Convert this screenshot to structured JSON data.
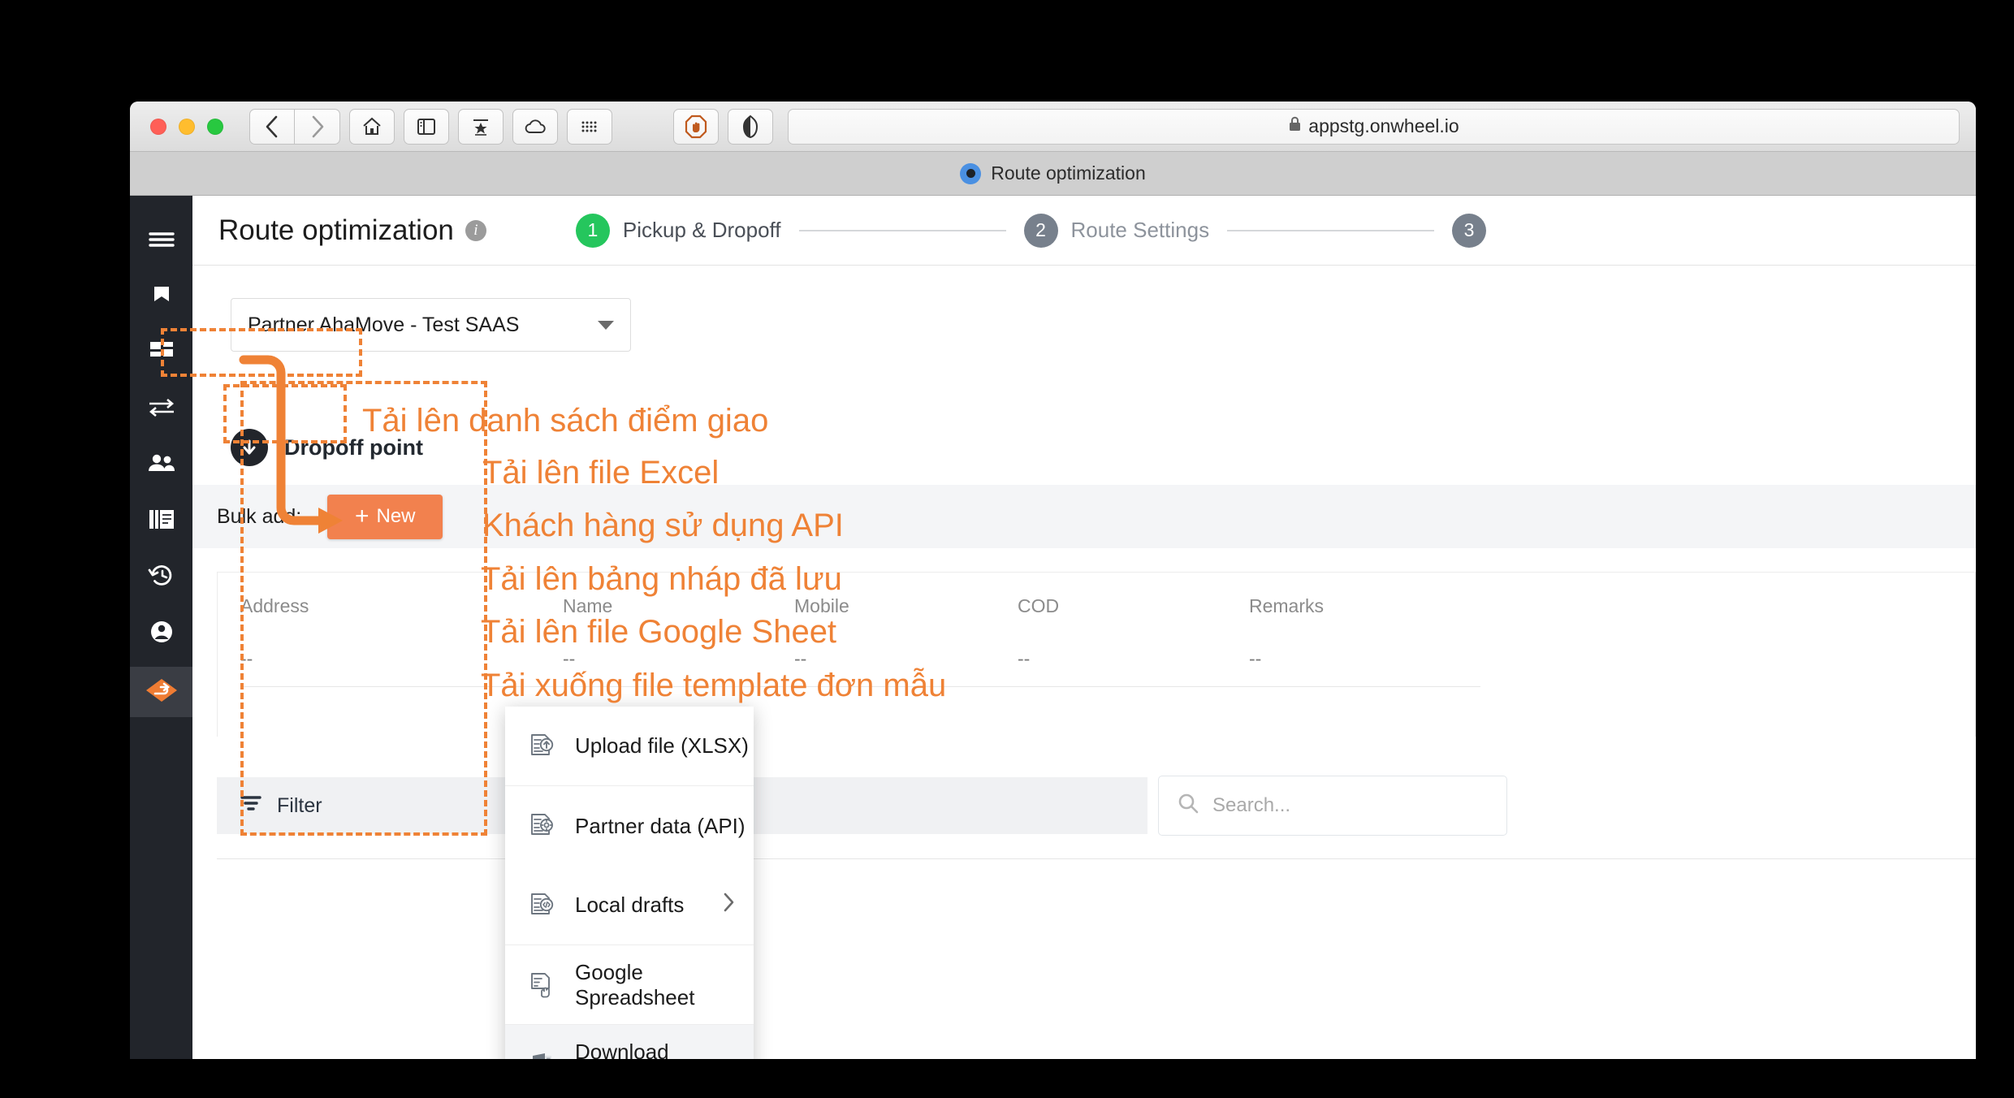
{
  "browser": {
    "url": "appstg.onwheel.io",
    "lock_icon": "lock-icon",
    "tab_title": "Route optimization",
    "toolbar_icons": [
      "back-icon",
      "forward-icon",
      "home-icon",
      "sidebar-icon",
      "reading-list-icon",
      "icloud-icon",
      "grid-icon",
      "adblock-icon",
      "privacy-icon"
    ]
  },
  "sidebar": {
    "items": [
      {
        "name": "menu-hamburger",
        "icon": "hamburger-icon"
      },
      {
        "name": "bookmark",
        "icon": "bookmark-icon"
      },
      {
        "name": "dashboard",
        "icon": "dashboard-icon"
      },
      {
        "name": "transfers",
        "icon": "transfer-arrows-icon"
      },
      {
        "name": "customers",
        "icon": "people-icon"
      },
      {
        "name": "orders",
        "icon": "documents-icon"
      },
      {
        "name": "history",
        "icon": "history-clock-icon"
      },
      {
        "name": "account",
        "icon": "account-circle-icon"
      },
      {
        "name": "route-optimization",
        "icon": "route-diamond-icon",
        "active": true
      }
    ]
  },
  "header": {
    "title": "Route optimization",
    "info_icon": "info-icon",
    "steps": [
      {
        "number": "1",
        "label": "Pickup & Dropoff",
        "state": "done"
      },
      {
        "number": "2",
        "label": "Route Settings",
        "state": "pending"
      },
      {
        "number": "3",
        "label": "",
        "state": "pending"
      }
    ]
  },
  "content": {
    "partner_select": {
      "value": "Partner AhaMove - Test SAAS",
      "caret_icon": "chevron-down-icon"
    },
    "dropoff": {
      "label": "Dropoff point",
      "icon": "arrow-down-icon"
    },
    "bulk_add": {
      "label": "Bulk add:",
      "new_button": "+ New",
      "plus": "+",
      "new_text": "New"
    },
    "table": {
      "columns": [
        "Address",
        "Name",
        "Mobile",
        "COD",
        "Remarks"
      ],
      "rows": [
        [
          "--",
          "--",
          "--",
          "--",
          "--"
        ]
      ]
    },
    "filter": {
      "label": "Filter",
      "icon": "filter-icon"
    },
    "search": {
      "placeholder": "Search...",
      "icon": "search-icon"
    }
  },
  "bulk_menu": {
    "items": [
      {
        "label": "Upload file (XLSX)",
        "icon": "file-upload-icon",
        "has_submenu": false
      },
      {
        "label": "Partner data (API)",
        "icon": "file-gear-icon",
        "has_submenu": false
      },
      {
        "label": "Local drafts",
        "icon": "file-code-icon",
        "has_submenu": true,
        "chevron": "chevron-right-icon"
      },
      {
        "label": "Google Spreadsheet",
        "icon": "spreadsheet-hand-icon",
        "has_submenu": false
      },
      {
        "label": "Download template",
        "icon": "excel-file-icon",
        "has_submenu": false
      }
    ]
  },
  "annotations": {
    "color": "#ef8236",
    "texts": [
      "Tải lên danh sách điểm giao",
      "Tải lên file Excel",
      "Khách hàng sử dụng API",
      "Tải lên bảng nháp đã lưu",
      "Tải lên file Google Sheet",
      "Tải xuống file template đơn mẫu"
    ]
  }
}
